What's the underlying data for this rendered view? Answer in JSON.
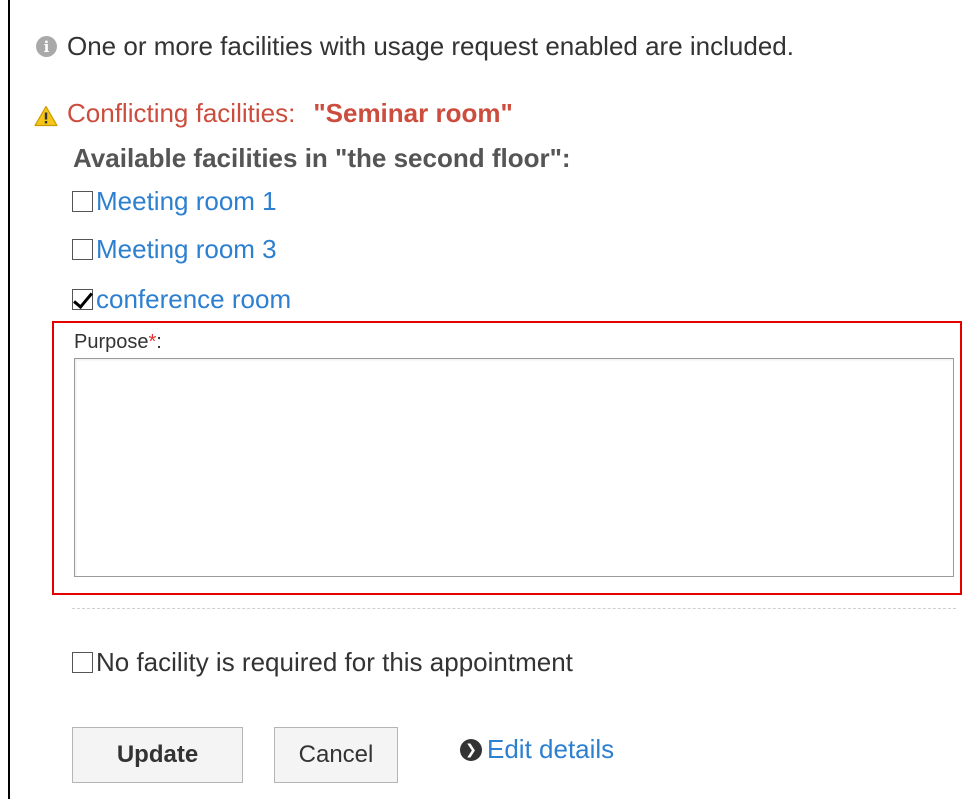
{
  "notice": {
    "info_icon": "info-icon",
    "text": "One or more facilities with usage request enabled are included."
  },
  "conflict": {
    "warning_icon": "warning-icon",
    "label": "Conflicting facilities:",
    "facility": "\"Seminar room\""
  },
  "available": {
    "heading": "Available facilities in \"the second floor\":",
    "facilities": [
      {
        "label": "Meeting room 1",
        "checked": false
      },
      {
        "label": "Meeting room 3",
        "checked": false
      },
      {
        "label": "conference room",
        "checked": true
      }
    ]
  },
  "purpose": {
    "label": "Purpose",
    "required_mark": "*",
    "suffix": ":",
    "value": "",
    "highlight_color": "#e50000"
  },
  "no_facility": {
    "label": "No facility is required for this appointment",
    "checked": false
  },
  "actions": {
    "update_label": "Update",
    "cancel_label": "Cancel",
    "edit_details_label": "Edit details",
    "edit_icon": "chevron-right-circle-icon"
  },
  "colors": {
    "link": "#2d7fd0",
    "warning_text": "#cc4c3d"
  }
}
